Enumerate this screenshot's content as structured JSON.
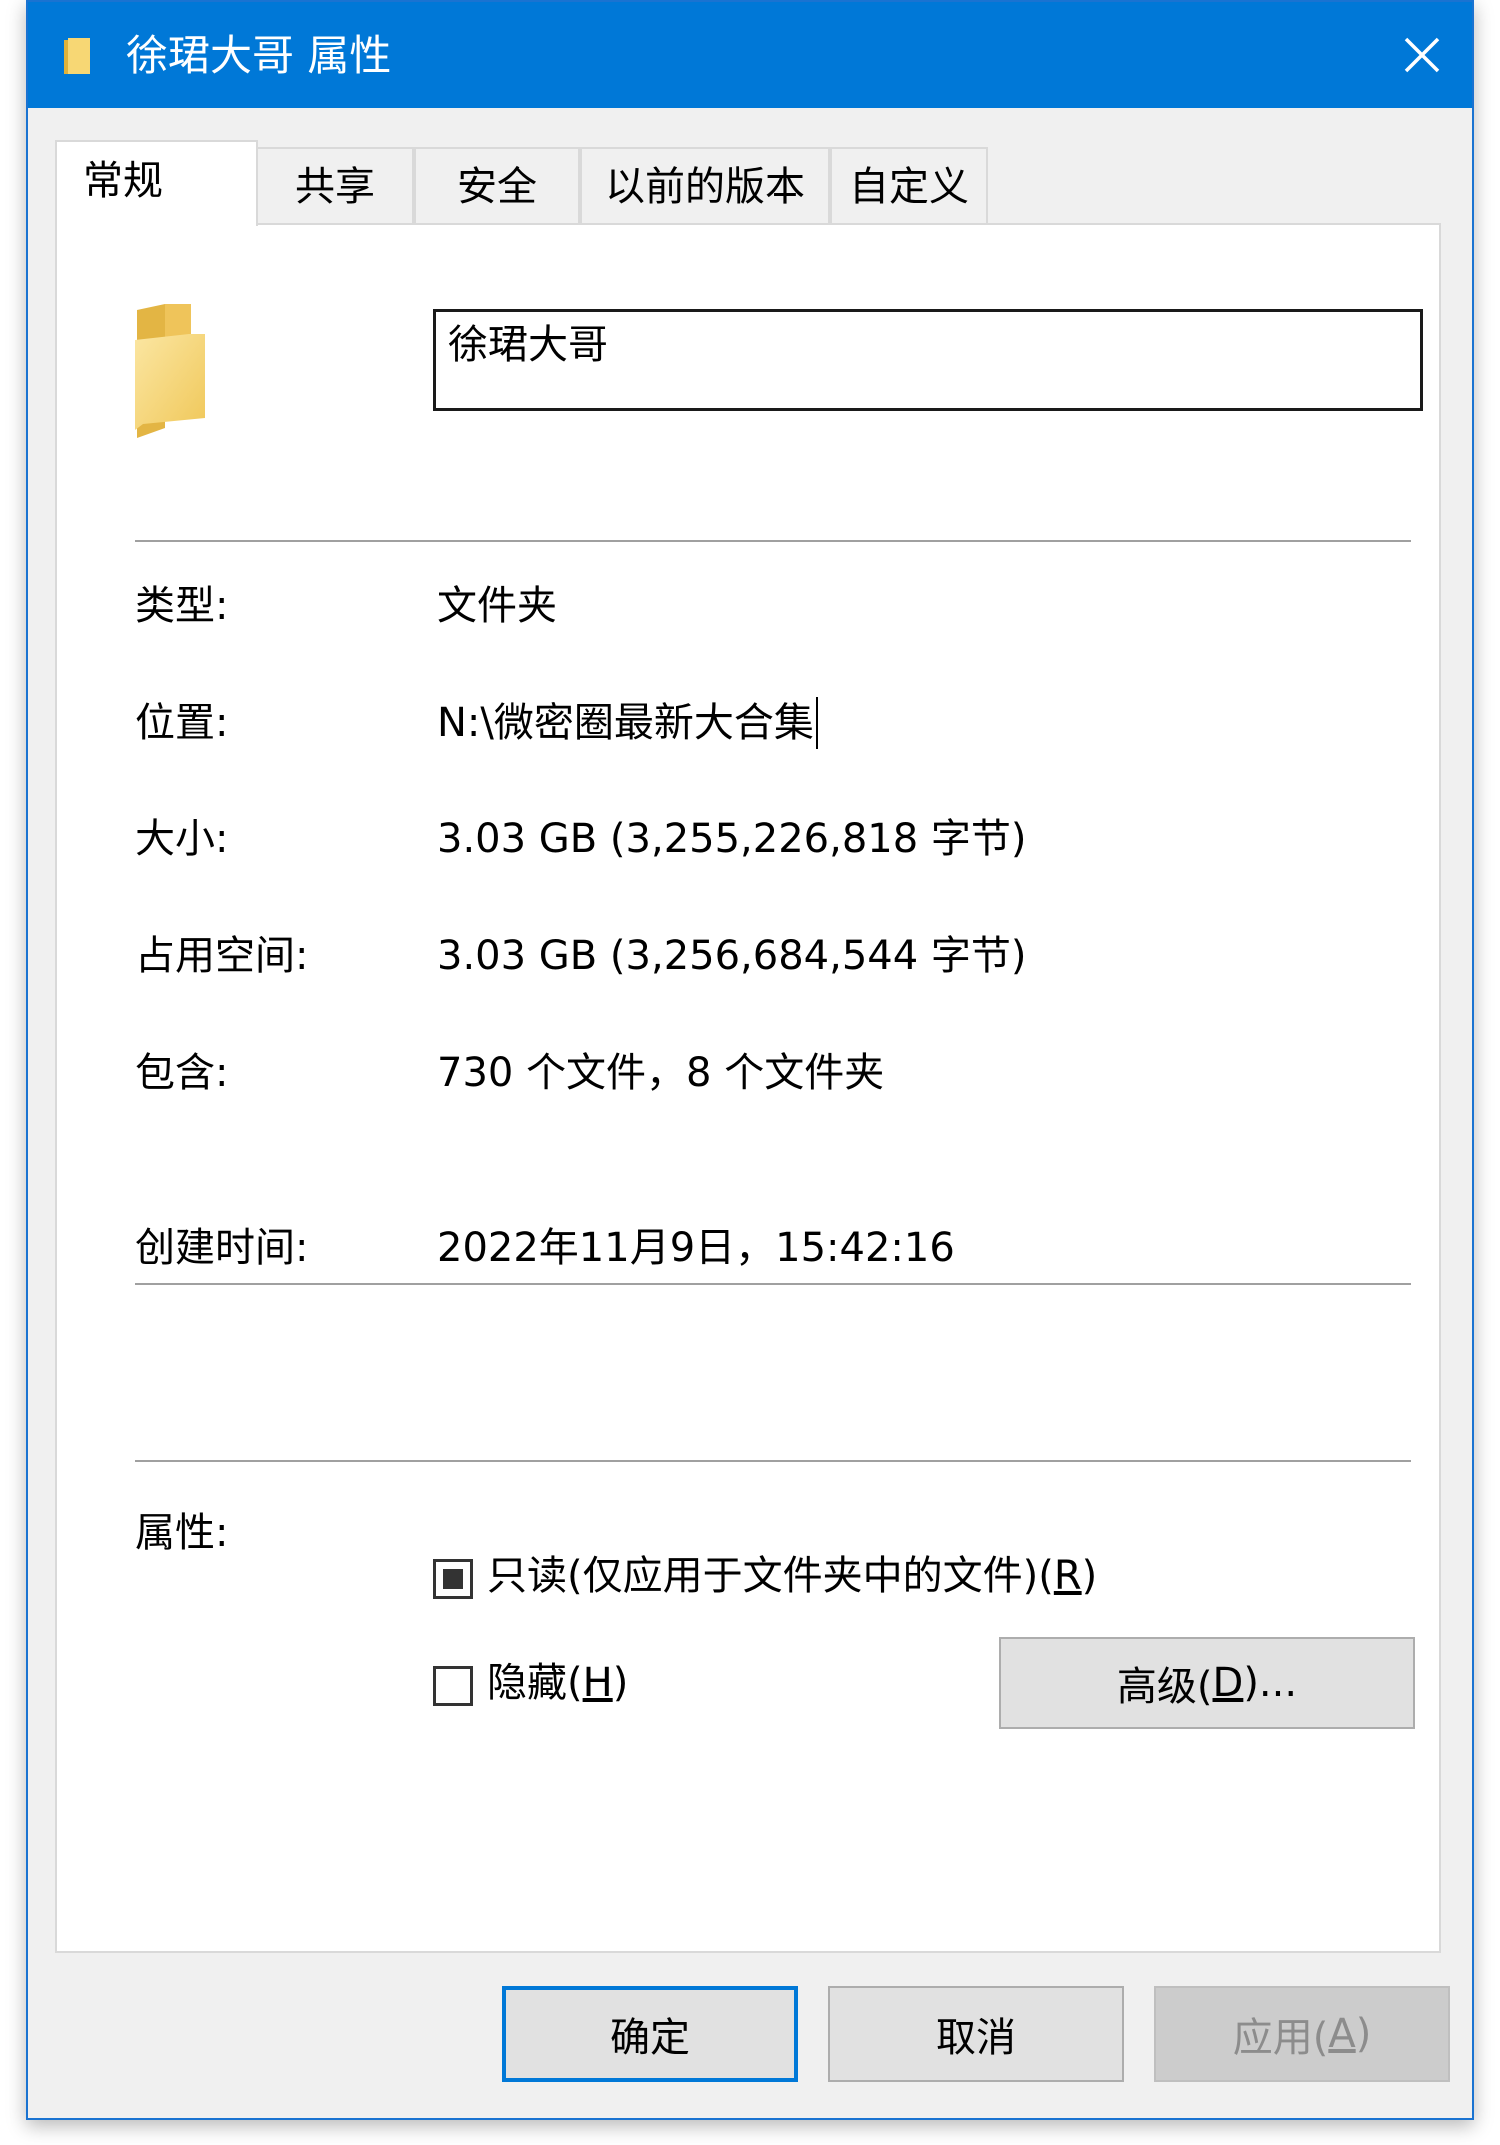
{
  "window": {
    "title": "徐珺大哥 属性",
    "close_icon": "close-icon"
  },
  "tabs": [
    {
      "label": "常规",
      "active": true
    },
    {
      "label": "共享",
      "active": false
    },
    {
      "label": "安全",
      "active": false
    },
    {
      "label": "以前的版本",
      "active": false
    },
    {
      "label": "自定义",
      "active": false
    }
  ],
  "general": {
    "folder_name": "徐珺大哥",
    "type_label": "类型:",
    "type_value": "文件夹",
    "location_label": "位置:",
    "location_value": "N:\\微密圈最新大合集",
    "size_label": "大小:",
    "size_value": "3.03 GB (3,255,226,818 字节)",
    "disk_label": "占用空间:",
    "disk_value": "3.03 GB (3,256,684,544 字节)",
    "contains_label": "包含:",
    "contains_value": "730 个文件，8 个文件夹",
    "created_label": "创建时间:",
    "created_value": "2022年11月9日，15:42:16",
    "attributes_label": "属性:",
    "readonly": {
      "label_main": "只读(仅应用于文件夹中的文件)(",
      "hotkey": "R",
      "label_end": ")",
      "state": "indeterminate"
    },
    "hidden": {
      "label_main": "隐藏(",
      "hotkey": "H",
      "label_end": ")",
      "checked": false
    },
    "advanced_button": {
      "label_main": "高级(",
      "hotkey": "D",
      "label_end": ")..."
    }
  },
  "buttons": {
    "ok": "确定",
    "cancel": "取消",
    "apply": {
      "label_main": "应用(",
      "hotkey": "A",
      "label_end": ")",
      "enabled": false
    }
  },
  "colors": {
    "titlebar": "#0078d7",
    "folder_yellow": "#f7d774",
    "folder_dark": "#e0b23a"
  }
}
